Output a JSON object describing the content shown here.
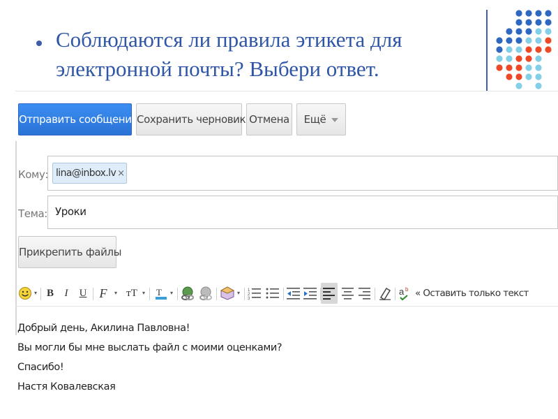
{
  "slide": {
    "question": "Соблюдаются ли правила этикета для электронной почты? Выбери ответ."
  },
  "decor": {
    "colors": {
      "dark_blue": "#2e67c0",
      "light_blue": "#83cfe8",
      "red": "#ec4928",
      "title": "#2f56a6"
    }
  },
  "compose": {
    "toolbar": {
      "send": "Отправить сообщение",
      "save_draft": "Сохранить черновик",
      "cancel": "Отмена",
      "more": "Ещё"
    },
    "to": {
      "label": "Кому:",
      "recipient": "lina@inbox.lv",
      "remove": "×"
    },
    "subject": {
      "label": "Тема:",
      "value": "Уроки"
    },
    "attach": "Прикрепить файлы",
    "formatting": {
      "icons": [
        "smiley-icon",
        "bold-icon",
        "italic-icon",
        "underline-icon",
        "font-icon",
        "text-size-icon",
        "text-color-icon",
        "link-icon",
        "image-icon",
        "video-icon",
        "numbered-list-icon",
        "bullet-list-icon",
        "indent-less-icon",
        "indent-more-icon",
        "align-left-icon",
        "align-center-icon",
        "align-right-icon",
        "remove-formatting-icon",
        "spell-check-icon"
      ],
      "bold": "B",
      "italic": "I",
      "underline": "U",
      "font": "F",
      "size": "тТ",
      "plain_text": "« Оставить только текст"
    },
    "body": {
      "lines": [
        "Добрый день, Акилина Павловна!",
        "Вы могли бы мне выслать файл с моими оценками?",
        "Спасибо!",
        "Настя Ковалевская"
      ]
    }
  }
}
